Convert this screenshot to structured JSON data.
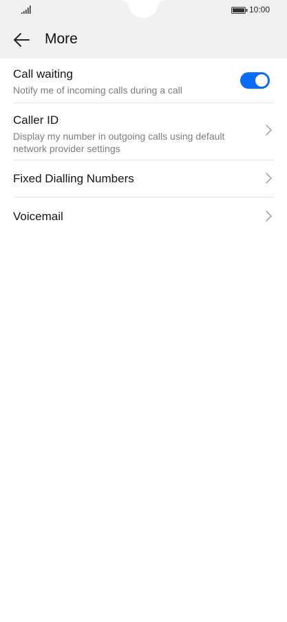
{
  "status_bar": {
    "signal_icon": "signal-strength-icon",
    "battery_icon": "battery-icon",
    "time": "10:00"
  },
  "header": {
    "back_icon": "arrow-left-icon",
    "title": "More"
  },
  "settings": {
    "call_waiting": {
      "title": "Call waiting",
      "subtitle": "Notify me of incoming calls during a call",
      "toggle_on": true,
      "toggle_color": "#0a6cf5"
    },
    "caller_id": {
      "title": "Caller ID",
      "subtitle": "Display my number in outgoing calls using default network provider settings",
      "icon": "chevron-right-icon"
    },
    "fixed_dialling": {
      "title": "Fixed Dialling Numbers",
      "icon": "chevron-right-icon"
    },
    "voicemail": {
      "title": "Voicemail",
      "icon": "chevron-right-icon"
    }
  }
}
